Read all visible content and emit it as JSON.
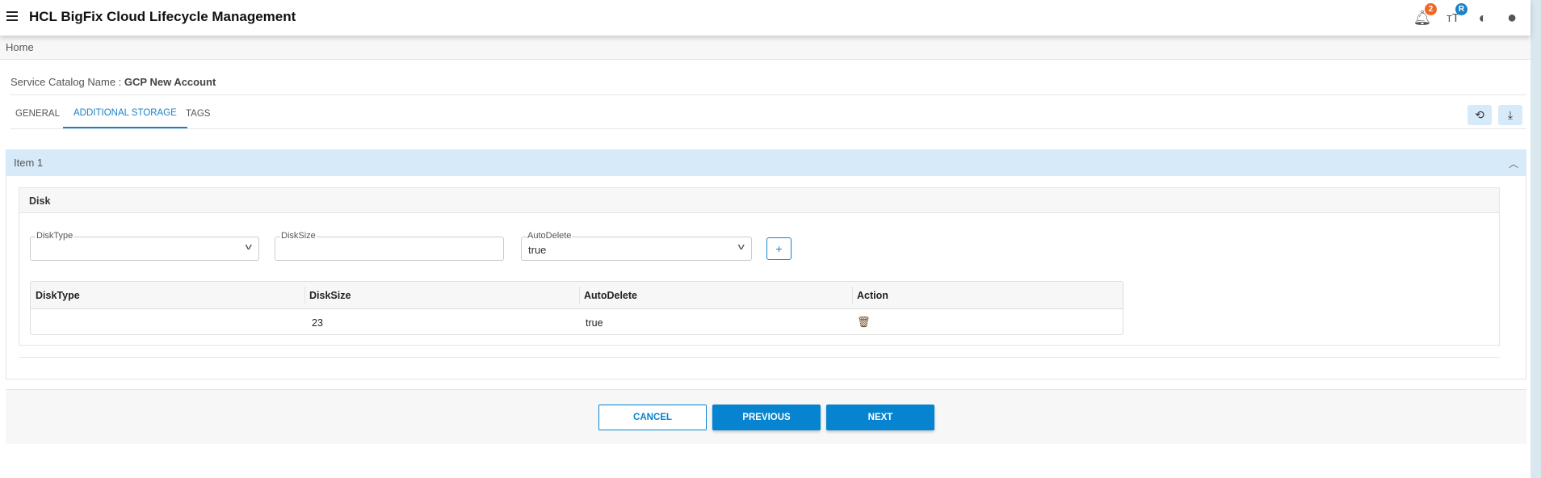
{
  "header": {
    "title": "HCL BigFix Cloud Lifecycle Management",
    "notifications_count": "2",
    "font_badge": "R"
  },
  "breadcrumb": "Home",
  "catalog": {
    "label": "Service Catalog Name : ",
    "value": "GCP New Account"
  },
  "tabs": [
    {
      "label": "GENERAL"
    },
    {
      "label": "ADDITIONAL STORAGE",
      "active": true
    },
    {
      "label": "TAGS"
    }
  ],
  "item": {
    "title": "Item 1"
  },
  "disk": {
    "title": "Disk",
    "fields": {
      "disktype_label": "DiskType",
      "disktype_value": "",
      "disksize_label": "DiskSize",
      "disksize_value": "",
      "autodelete_label": "AutoDelete",
      "autodelete_value": "true"
    },
    "add_label": "+",
    "table": {
      "columns": [
        "DiskType",
        "DiskSize",
        "AutoDelete",
        "Action"
      ],
      "rows": [
        {
          "disktype": "",
          "disksize": "23",
          "autodelete": "true"
        }
      ]
    }
  },
  "buttons": {
    "cancel": "CANCEL",
    "previous": "PREVIOUS",
    "next": "NEXT"
  },
  "colors": {
    "accent": "#0784cf",
    "badge_orange": "#f26522",
    "badge_blue": "#1a82c8",
    "panel_header": "#d7eaf9"
  }
}
